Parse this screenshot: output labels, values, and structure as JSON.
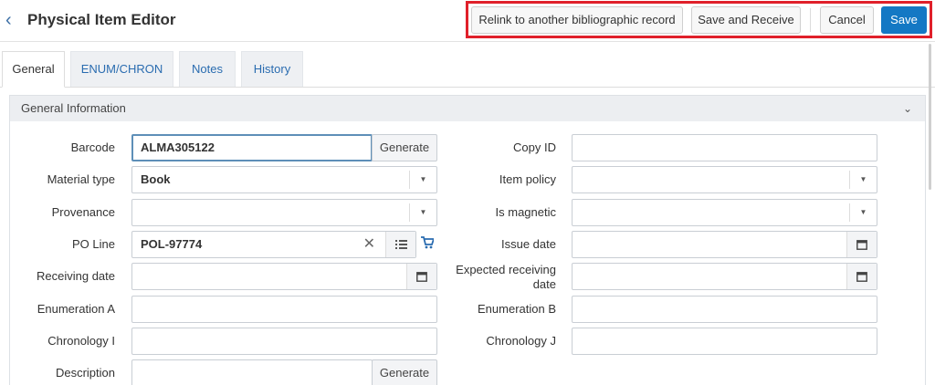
{
  "header": {
    "title": "Physical Item Editor",
    "buttons": {
      "relink": "Relink to another bibliographic record",
      "save_receive": "Save and Receive",
      "cancel": "Cancel",
      "save": "Save"
    }
  },
  "tabs": [
    "General",
    "ENUM/CHRON",
    "Notes",
    "History"
  ],
  "section": {
    "title": "General Information"
  },
  "fields": {
    "barcode": {
      "label": "Barcode",
      "value": "ALMA305122",
      "button": "Generate"
    },
    "material_type": {
      "label": "Material type",
      "value": "Book"
    },
    "provenance": {
      "label": "Provenance",
      "value": ""
    },
    "po_line": {
      "label": "PO Line",
      "value": "POL-97774"
    },
    "receiving_date": {
      "label": "Receiving date",
      "value": ""
    },
    "enumeration_a": {
      "label": "Enumeration A",
      "value": ""
    },
    "chronology_i": {
      "label": "Chronology I",
      "value": ""
    },
    "description": {
      "label": "Description",
      "value": "",
      "button": "Generate"
    },
    "copy_id": {
      "label": "Copy ID",
      "value": ""
    },
    "item_policy": {
      "label": "Item policy",
      "value": ""
    },
    "is_magnetic": {
      "label": "Is magnetic",
      "value": ""
    },
    "issue_date": {
      "label": "Issue date",
      "value": ""
    },
    "expected_receiving_date": {
      "label_line1": "Expected receiving",
      "label_line2": "date",
      "value": ""
    },
    "enumeration_b": {
      "label": "Enumeration B",
      "value": ""
    },
    "chronology_j": {
      "label": "Chronology J",
      "value": ""
    }
  },
  "colors": {
    "primary": "#1478c4",
    "highlight": "#e0202a",
    "link": "#2a6cb0"
  }
}
